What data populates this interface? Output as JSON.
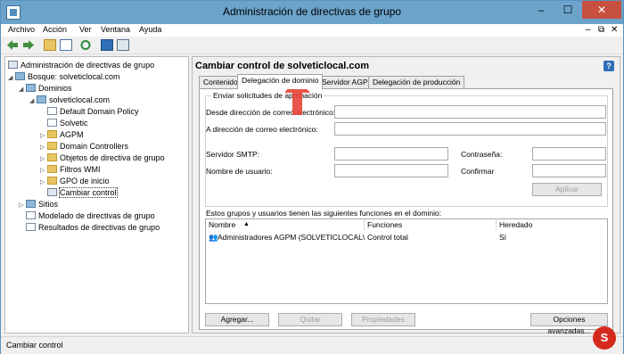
{
  "window": {
    "title": "Administración de directivas de grupo"
  },
  "title_buttons": {
    "minimize": "–",
    "maximize": "☐",
    "close": "✕"
  },
  "menu": [
    "Archivo",
    "Acción",
    "Ver",
    "Ventana",
    "Ayuda"
  ],
  "mdi_controls": [
    "–",
    "⧉",
    "✕"
  ],
  "tree": {
    "root": "Administración de directivas de grupo",
    "forest": "Bosque: solveticlocal.com",
    "domains": "Dominios",
    "domain": "solveticlocal.com",
    "children": [
      "Default Domain Policy",
      "Solvetic",
      "AGPM",
      "Domain Controllers",
      "Objetos de directiva de grupo",
      "Filtros WMI",
      "GPO de inicio",
      "Cambiar control"
    ],
    "sites": "Sitios",
    "modeling": "Modelado de directivas de grupo",
    "results": "Resultados de directivas de grupo"
  },
  "content": {
    "title": "Cambiar control de solveticlocal.com",
    "help": "?",
    "tabs": [
      "Contenido",
      "Delegación de dominio",
      "Servidor AGPM",
      "Delegación de producción"
    ],
    "approval": {
      "legend": "Enviar solicitudes de aprobación",
      "from_label": "Desde dirección de correo electrónico:",
      "from_value": "",
      "to_label": "A dirección de correo electrónico:",
      "to_value": "",
      "smtp_label": "Servidor SMTP:",
      "smtp_value": "",
      "password_label": "Contraseña:",
      "password_value": "",
      "user_label": "Nombre de usuario:",
      "user_value": "",
      "confirm_label": "Confirmar",
      "confirm_value": "",
      "apply": "Aplicar"
    },
    "roles_label": "Estos grupos y usuarios tienen las siguientes funciones en el dominio:",
    "columns": [
      "Nombre",
      "Funciones",
      "Heredado"
    ],
    "rows": [
      {
        "name": "Administradores AGPM (SOLVETICLOCAL\\...",
        "roles": "Control total",
        "inherited": "Sí"
      }
    ],
    "buttons": {
      "add": "Agregar...",
      "remove": "Quitar",
      "properties": "Propiedades",
      "advanced": "Opciones avanzadas..."
    }
  },
  "status": "Cambiar control",
  "logo": "S",
  "colors": {
    "titlebar": "#6ba3cb",
    "close": "#c7503f",
    "arrow": "#e8463a"
  }
}
